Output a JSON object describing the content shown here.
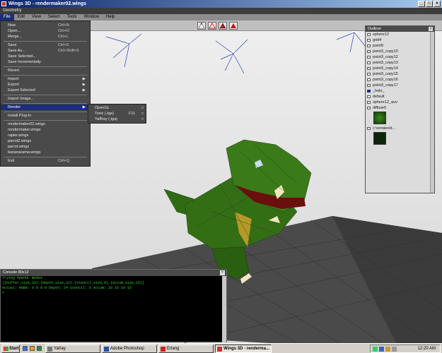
{
  "window": {
    "title": "Wings 3D - rendermaker02.wings",
    "panel_title": "Geometry",
    "controls": {
      "minimize": "_",
      "maximize": "□",
      "close": "×"
    }
  },
  "menubar": {
    "items": [
      {
        "label": "File"
      },
      {
        "label": "Edit"
      },
      {
        "label": "View"
      },
      {
        "label": "Select"
      },
      {
        "label": "Tools"
      },
      {
        "label": "Window"
      },
      {
        "label": "Help"
      }
    ]
  },
  "toolbar": {
    "modes": [
      "vertex-mode",
      "edge-mode",
      "face-mode",
      "body-mode"
    ],
    "accent_color": "#cc1111"
  },
  "file_menu": {
    "groups": [
      [
        {
          "label": "New",
          "shortcut": "Ctrl+N"
        },
        {
          "label": "Open...",
          "shortcut": "Ctrl+O"
        },
        {
          "label": "Merge...",
          "shortcut": "Ctrl+L"
        }
      ],
      [
        {
          "label": "Save",
          "shortcut": "Ctrl+S"
        },
        {
          "label": "Save As...",
          "shortcut": "Ctrl+Shift+S"
        },
        {
          "label": "Save Selected...",
          "shortcut": ""
        },
        {
          "label": "Save Incrementally",
          "shortcut": ""
        }
      ],
      [
        {
          "label": "Revert",
          "shortcut": ""
        }
      ],
      [
        {
          "label": "Import",
          "shortcut": "",
          "arrow": "▶"
        },
        {
          "label": "Export",
          "shortcut": "",
          "arrow": "▶"
        },
        {
          "label": "Export Selected",
          "shortcut": "",
          "arrow": "▶"
        }
      ],
      [
        {
          "label": "Import Image...",
          "shortcut": ""
        }
      ],
      [
        {
          "label": "Render",
          "shortcut": "",
          "arrow": "▶",
          "highlighted": true
        }
      ],
      [
        {
          "label": "Install Plug-In",
          "shortcut": ""
        }
      ],
      [
        {
          "label": "rendermaker02.wings",
          "shortcut": ""
        },
        {
          "label": "rendermaker.wings",
          "shortcut": ""
        },
        {
          "label": "rapier.wings",
          "shortcut": ""
        },
        {
          "label": "parrot2.wings",
          "shortcut": ""
        },
        {
          "label": "parrot.wings",
          "shortcut": ""
        },
        {
          "label": "bananarama.wings",
          "shortcut": ""
        }
      ],
      [
        {
          "label": "Exit",
          "shortcut": "Ctrl+Q"
        }
      ]
    ]
  },
  "render_submenu": {
    "items": [
      {
        "label": "OpenGL",
        "shortcut": "",
        "option": "□"
      },
      {
        "label": "Toxic (.tga)",
        "shortcut": "F11",
        "option": "□"
      },
      {
        "label": "YafRay (.tga)",
        "shortcut": "",
        "option": "□"
      }
    ]
  },
  "outliner": {
    "title": "Outliner",
    "close": "×",
    "items": [
      {
        "label": "sphere12"
      },
      {
        "label": "grid4"
      },
      {
        "label": "point9"
      },
      {
        "label": "point3_copy10"
      },
      {
        "label": "point3_copy12"
      },
      {
        "label": "point3_copy13"
      },
      {
        "label": "point3_copy14"
      },
      {
        "label": "point3_copy15"
      },
      {
        "label": "point3_copy16"
      },
      {
        "label": "point3_copy17"
      },
      {
        "label": "_hole_",
        "selected": true
      },
      {
        "label": "default"
      },
      {
        "label": "sphere12_auv"
      },
      {
        "label": "diffuse5"
      },
      {
        "label": "c:\\renders\\t..."
      }
    ]
  },
  "console": {
    "title": "Console 80x12",
    "close": "×",
    "lines": [
      "Trying OpenGL modes",
      "  [{buffer_size,32},{depth_size,32},{stencil_size,8},{accum_size,16}]",
      "Actual: RGBA: 8 8 8 0 Depth: 24 Stencil: 8 Accum: 16 16 16 16",
      ">"
    ]
  },
  "taskbar": {
    "start_label": "Start",
    "tasks": [
      {
        "label": "Yafray",
        "active": false
      },
      {
        "label": "Adobe Photoshop",
        "active": false
      },
      {
        "label": "Erlang",
        "active": false
      },
      {
        "label": "Wings 3D - renderma...",
        "active": true
      }
    ],
    "clock": "12:20 AM"
  }
}
